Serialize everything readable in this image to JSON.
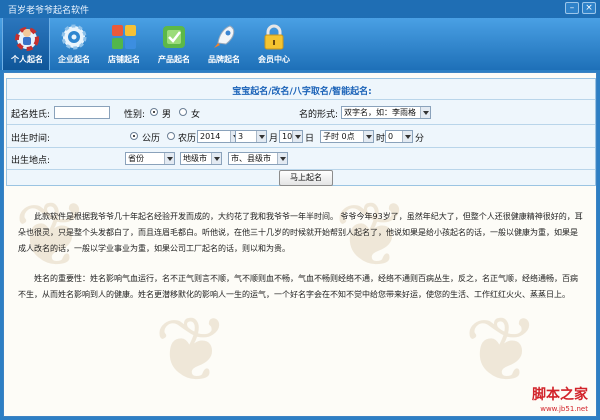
{
  "window": {
    "title": "百岁老爷爷起名软件",
    "min": "–",
    "close": "×"
  },
  "toolbar": [
    {
      "label": "个人起名",
      "icon": "person-lifebuoy-icon"
    },
    {
      "label": "企业起名",
      "icon": "gear-icon"
    },
    {
      "label": "店铺起名",
      "icon": "store-tiles-icon"
    },
    {
      "label": "产品起名",
      "icon": "product-cube-icon"
    },
    {
      "label": "品牌起名",
      "icon": "rocket-icon"
    },
    {
      "label": "会员中心",
      "icon": "padlock-icon"
    }
  ],
  "form": {
    "title": "宝宝起名/改名/八字取名/智能起名:",
    "surname_label": "起名姓氏:",
    "surname_value": "",
    "gender_label": "性别:",
    "gender_male": "男",
    "gender_female": "女",
    "name_format_label": "名的形式:",
    "name_format_value": "双字名，如：李雨格",
    "birth_time_label": "出生时间:",
    "calendar_solar": "公历",
    "calendar_lunar": "农历",
    "year": "2014",
    "year_unit": "年",
    "month": "3",
    "month_unit": "月",
    "day": "10",
    "day_unit": "日",
    "hour": "子时  0点",
    "hour_unit": "时",
    "minute": "0",
    "minute_unit": "分",
    "birthplace_label": "出生地点:",
    "province": "省份",
    "city": "地级市",
    "county": "市、县级市",
    "submit": "马上起名"
  },
  "article": {
    "p1": "此款软件是根据我爷爷几十年起名经验开发而成的，大约花了我和我爷爷一年半时间。 爷爷今年93岁了，虽然年纪大了，但整个人还很健康精神很好的，耳朵也很灵，只是整个头发都白了，而且连眉毛都白。听他说，在他三十几岁的时候就开始帮别人起名了，他说如果是给小孩起名的话，一般以健康为重，如果是成人改名的话，一般以学业事业为重，如果公司工厂起名的话，则以和为贵。",
    "p2": "姓名的重要性：姓名影响气血运行，名不正气则言不顺，气不顺则血不畅，气血不畅则经络不通，经络不通则百病丛生，反之，名正气顺，经络通畅，百病不生，从而姓名影响到人的健康。姓名更潜移默化的影响人一生的运气，一个好名字会在不知不觉中给您带来好运，使您的生活、工作红红火火、蒸蒸日上。"
  },
  "logo": {
    "text": "脚本之家",
    "url": "www.jb51.net"
  }
}
